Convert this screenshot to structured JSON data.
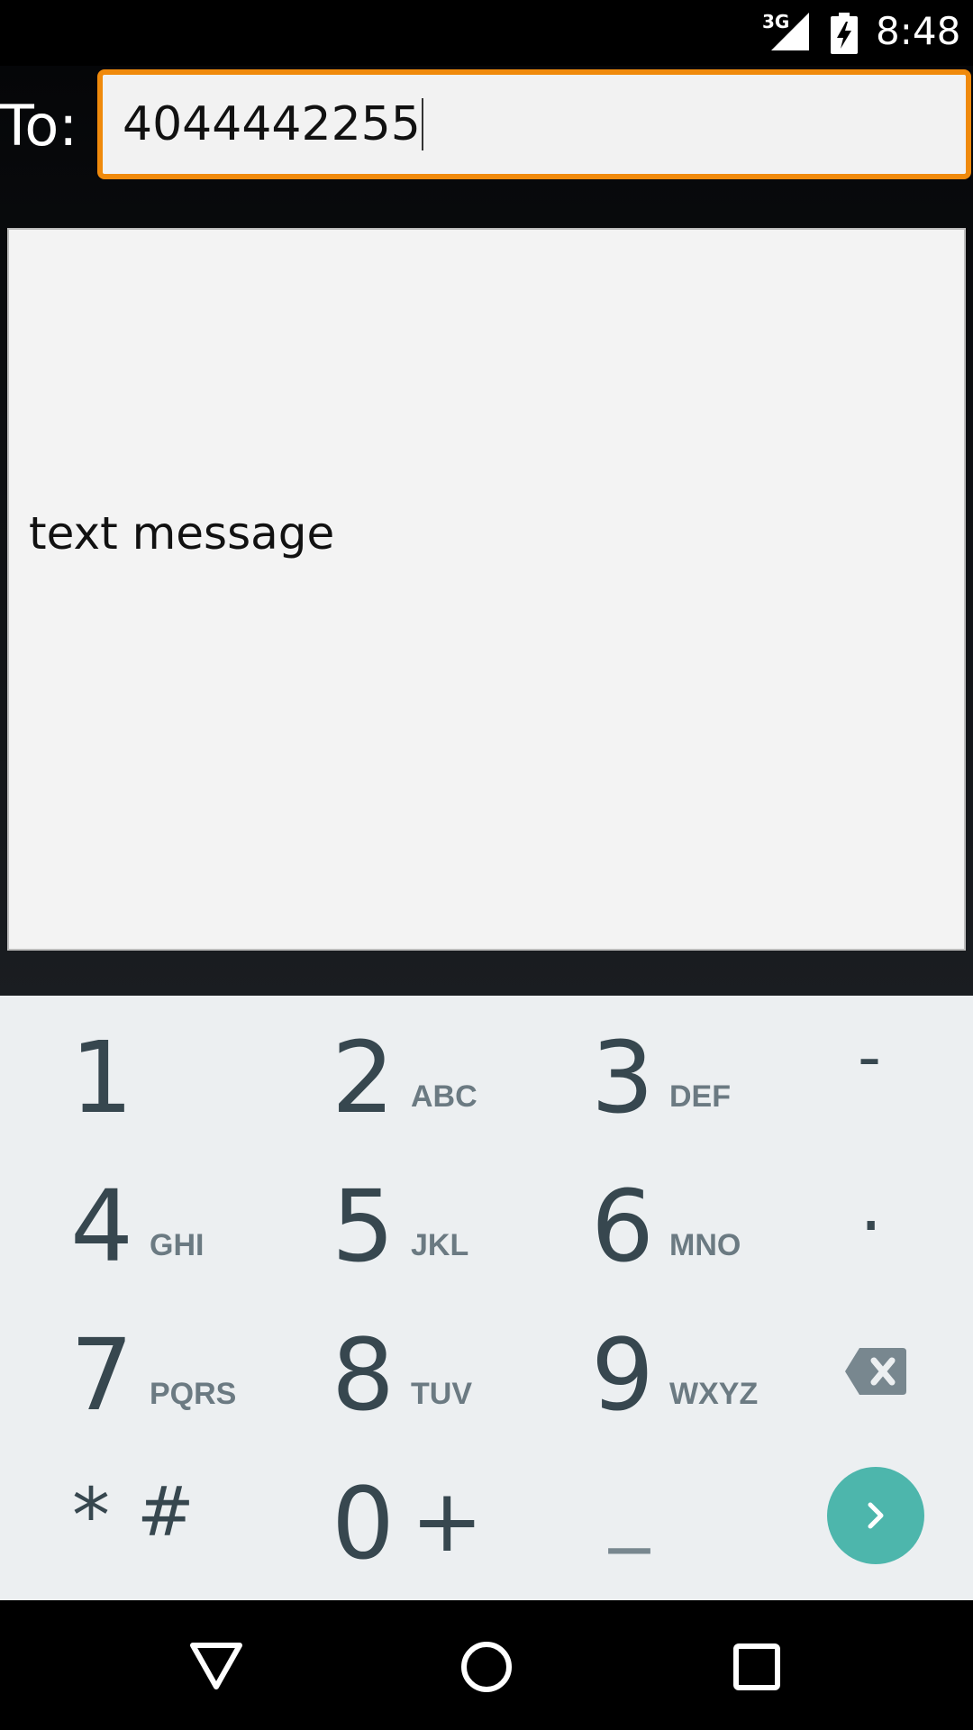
{
  "status_bar": {
    "network": "3G",
    "time": "8:48"
  },
  "compose": {
    "to_label": "To:",
    "to_value": "4044442255",
    "message_text": "text message"
  },
  "keypad": {
    "keys": [
      {
        "digit": "1",
        "letters": ""
      },
      {
        "digit": "2",
        "letters": "ABC"
      },
      {
        "digit": "3",
        "letters": "DEF"
      },
      {
        "digit": "-",
        "letters": ""
      },
      {
        "digit": "4",
        "letters": "GHI"
      },
      {
        "digit": "5",
        "letters": "JKL"
      },
      {
        "digit": "6",
        "letters": "MNO"
      },
      {
        "digit": ".",
        "letters": ""
      },
      {
        "digit": "7",
        "letters": "PQRS"
      },
      {
        "digit": "8",
        "letters": "TUV"
      },
      {
        "digit": "9",
        "letters": "WXYZ"
      },
      {
        "digit": "*",
        "letters": ""
      },
      {
        "digit": "#",
        "letters": ""
      },
      {
        "digit": "0",
        "letters": ""
      },
      {
        "digit": "+",
        "letters": ""
      },
      {
        "digit": "_",
        "letters": ""
      }
    ],
    "backspace_icon": "backspace-icon",
    "next_icon": "chevron-right-icon",
    "accent_color": "#4db6ac"
  },
  "nav_bar": {
    "back_icon": "back-triangle-icon",
    "home_icon": "home-circle-icon",
    "recents_icon": "recents-square-icon"
  },
  "colors": {
    "focus_border": "#f08a0c",
    "key_text": "#37474f",
    "keypad_background": "#eceff1"
  }
}
